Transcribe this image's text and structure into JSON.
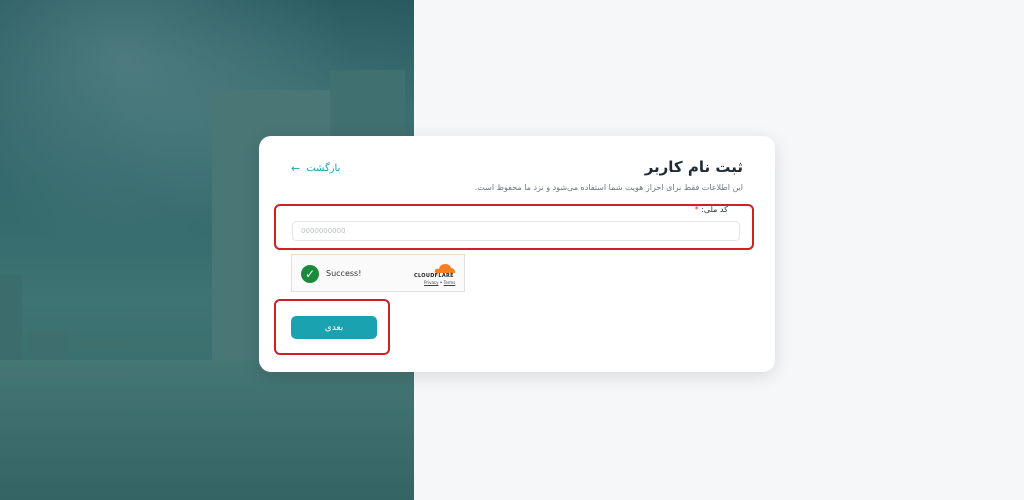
{
  "form": {
    "title": "ثبت نام کاربر",
    "subtitle": "این اطلاعات فقط برای احراز هویت شما استفاده می‌شود و نزد ما محفوظ است.",
    "back_label": "بازگشت",
    "national_id_label": "کد ملی:",
    "required_mark": "*",
    "national_id_value": "0000000000",
    "next_label": "بعدی"
  },
  "captcha": {
    "status": "Success!",
    "brand": "CLOUDFLARE",
    "privacy_label": "Privacy",
    "separator": "•",
    "terms_label": "Terms"
  },
  "colors": {
    "accent": "#1aa2b0",
    "highlight": "#d21f26",
    "success": "#1b8a3c",
    "cloudflare": "#f38020"
  }
}
